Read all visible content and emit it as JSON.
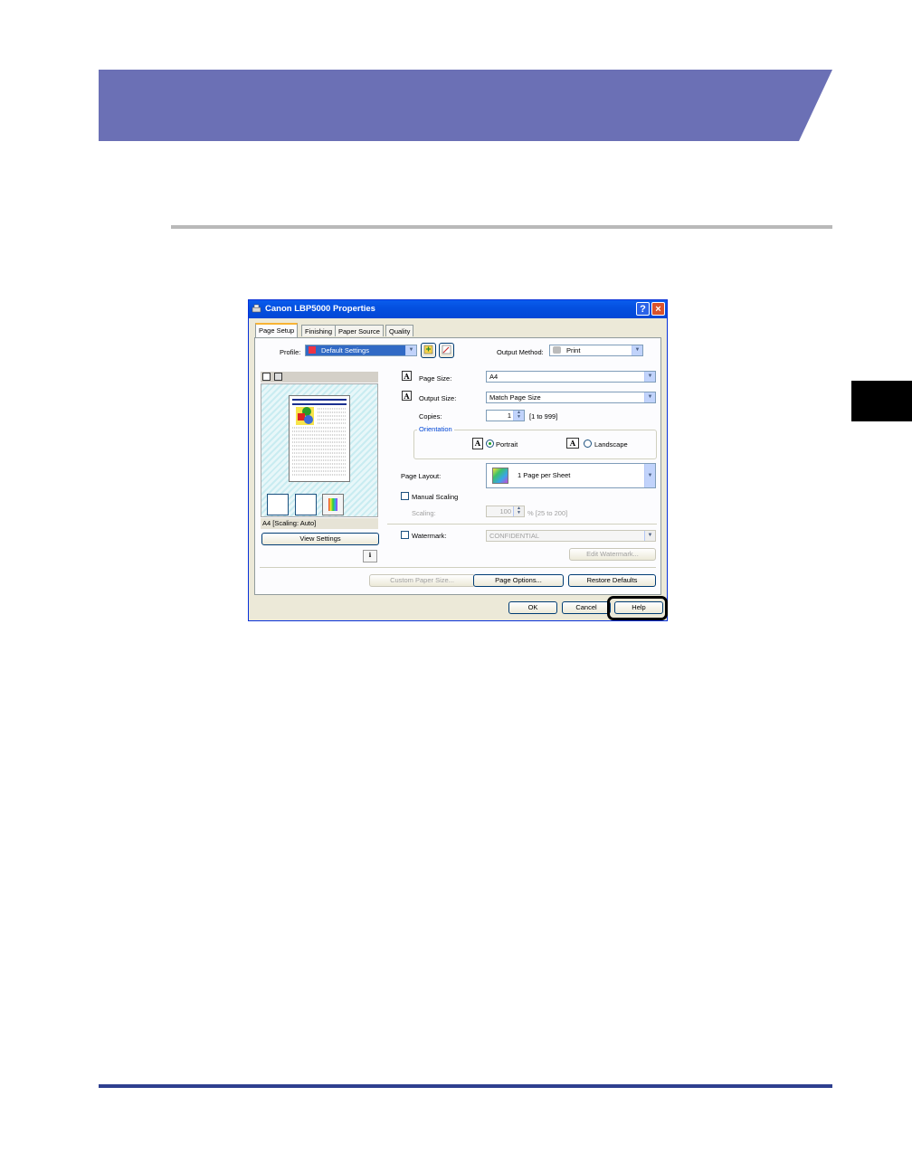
{
  "dialog": {
    "title": "Canon LBP5000 Properties",
    "tabs": [
      "Page Setup",
      "Finishing",
      "Paper Source",
      "Quality"
    ],
    "profile_label": "Profile:",
    "profile_value": "Default Settings",
    "output_method_label": "Output Method:",
    "output_method_value": "Print",
    "page_size_label": "Page Size:",
    "page_size_value": "A4",
    "output_size_label": "Output Size:",
    "output_size_value": "Match Page Size",
    "copies_label": "Copies:",
    "copies_value": "1",
    "copies_range": "[1 to 999]",
    "orientation_label": "Orientation",
    "portrait_label": "Portrait",
    "landscape_label": "Landscape",
    "page_layout_label": "Page Layout:",
    "page_layout_value": "1 Page per Sheet",
    "manual_scaling_label": "Manual Scaling",
    "scaling_label": "Scaling:",
    "scaling_value": "100",
    "scaling_range": "% [25 to 200]",
    "watermark_label": "Watermark:",
    "watermark_value": "CONFIDENTIAL",
    "edit_watermark_button": "Edit Watermark...",
    "preview_caption": "A4 [Scaling: Auto]",
    "view_settings_button": "View Settings",
    "custom_paper_size_button": "Custom Paper Size...",
    "page_options_button": "Page Options...",
    "restore_defaults_button": "Restore Defaults",
    "ok_button": "OK",
    "cancel_button": "Cancel",
    "help_button": "Help"
  },
  "colors": {
    "banner": "#6b70b5",
    "rule": "#b9b9b9",
    "footer_rule": "#2e3f8f",
    "titlebar": "#0450e0"
  }
}
